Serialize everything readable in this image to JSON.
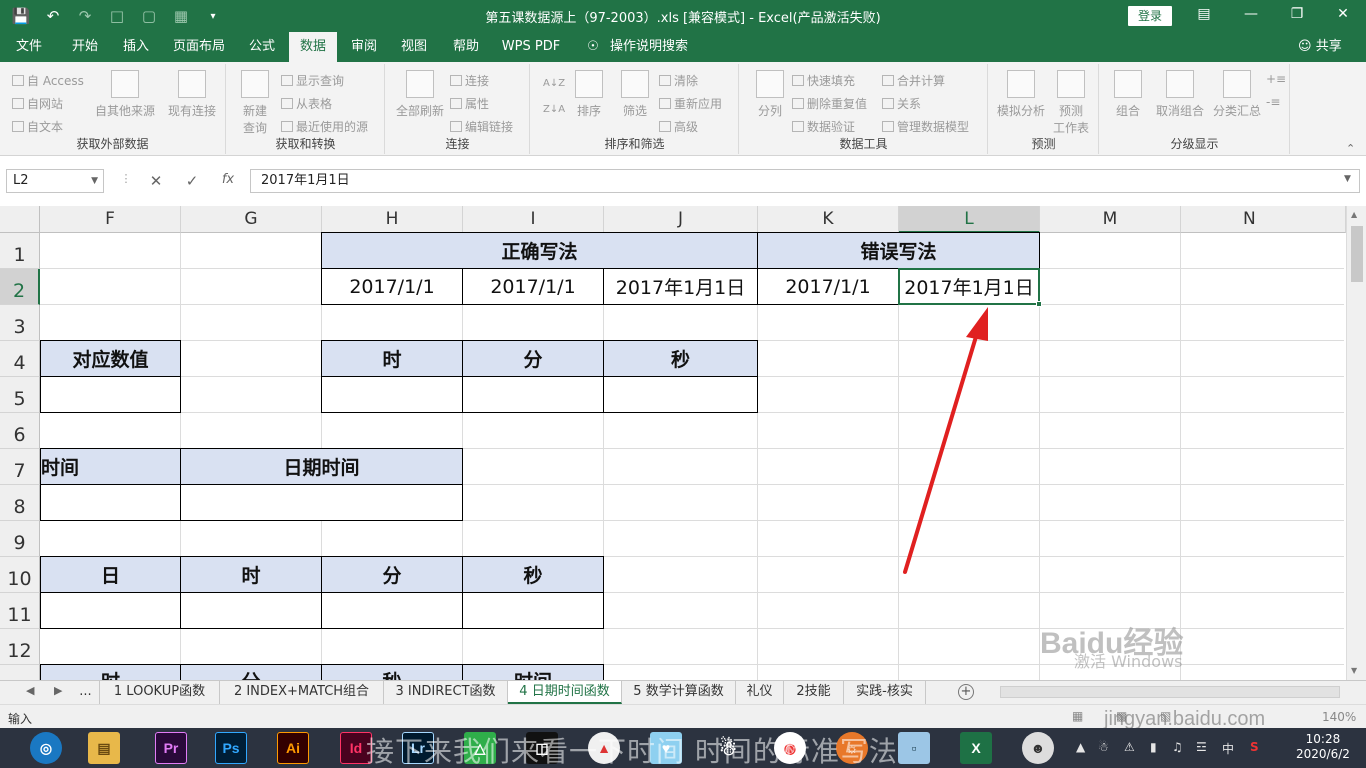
{
  "window": {
    "title": "第五课数据源上（97-2003）.xls  [兼容模式]  -  Excel(产品激活失败)",
    "login_label": "登录",
    "share_label": "共享"
  },
  "tabs": [
    "文件",
    "开始",
    "插入",
    "页面布局",
    "公式",
    "数据",
    "审阅",
    "视图",
    "帮助",
    "WPS PDF",
    "操作说明搜索"
  ],
  "active_tab": "数据",
  "ribbon": {
    "groups": {
      "external": "获取外部数据",
      "transform": "获取和转换",
      "connections": "连接",
      "sortfilter": "排序和筛选",
      "datatools": "数据工具",
      "forecast": "预测",
      "outline": "分级显示"
    },
    "buttons": {
      "from_access": "自 Access",
      "from_web": "自网站",
      "from_text": "自文本",
      "from_other": "自其他来源",
      "existing": "现有连接",
      "new_query_1": "新建",
      "new_query_2": "查询",
      "show_query": "显示查询",
      "from_table": "从表格",
      "recent_sources": "最近使用的源",
      "refresh_all": "全部刷新",
      "connections": "连接",
      "properties": "属性",
      "edit_links": "编辑链接",
      "sort": "排序",
      "filter": "筛选",
      "clear": "清除",
      "reapply": "重新应用",
      "advanced": "高级",
      "split": "分列",
      "flash_fill": "快速填充",
      "remove_dup": "删除重复值",
      "validate": "数据验证",
      "consolidate": "合并计算",
      "relations": "关系",
      "manage_model": "管理数据模型",
      "what_if": "模拟分析",
      "forecast_1": "预测",
      "forecast_2": "工作表",
      "group": "组合",
      "ungroup": "取消组合",
      "subtotal": "分类汇总"
    }
  },
  "formula_bar": {
    "name_box": "L2",
    "fx": "fx",
    "content": "2017年1月1日"
  },
  "columns": [
    "F",
    "G",
    "H",
    "I",
    "J",
    "K",
    "L",
    "M",
    "N"
  ],
  "rows": [
    "1",
    "2",
    "3",
    "4",
    "5",
    "6",
    "7",
    "8",
    "9",
    "10",
    "11",
    "12"
  ],
  "cells": {
    "correct_header": "正确写法",
    "wrong_header": "错误写法",
    "h2": "2017/1/1",
    "i2": "2017/1/1",
    "j2": "2017年1月1日",
    "k2": "2017/1/1",
    "l2": "2017年1月1日",
    "f4": "对应数值",
    "h4": "时",
    "i4": "分",
    "j4": "秒",
    "f7": "时间",
    "g7": "日期时间",
    "f10": "日",
    "g10": "时",
    "h10": "分",
    "i10": "秒",
    "f13": "时",
    "g13": "分",
    "h13": "秒",
    "i13": "时间"
  },
  "sheets": [
    "...",
    "1 LOOKUP函数",
    "2 INDEX+MATCH组合",
    "3 INDIRECT函数",
    "4 日期时间函数",
    "5 数学计算函数",
    "礼仪",
    "2技能",
    "实践-核实"
  ],
  "active_sheet": "4 日期时间函数",
  "status": {
    "mode": "输入",
    "zoom": "140%"
  },
  "overlay": {
    "activation": "激活 Windows",
    "baidu": "Baidu经验",
    "baidu_url": "jingyan.baidu.com",
    "subtitle": "接下来我们来看一下时间 时间的标准写法"
  },
  "taskbar": {
    "apps": [
      "Pr",
      "Ps",
      "Ai",
      "Id",
      "Lr",
      "X"
    ],
    "time": "10:28",
    "date": "2020/6/2",
    "ime": "中"
  },
  "colors": {
    "excel_green": "#217346",
    "header_fill": "#d9e1f2",
    "arrow_red": "#e02020"
  }
}
